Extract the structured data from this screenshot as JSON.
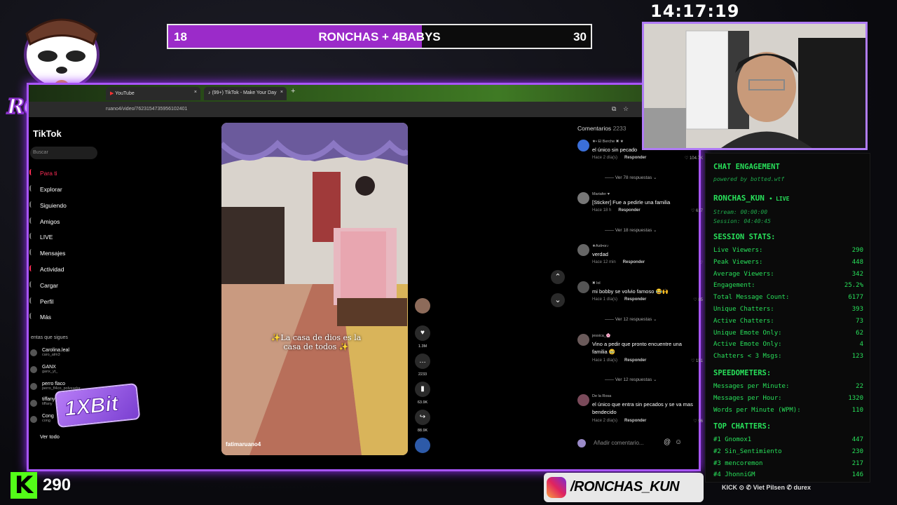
{
  "clock": "14:17:19",
  "goal": {
    "left": "18",
    "title": "RONCHAS + 4BABYS",
    "right": "30",
    "progress_fraction": 0.6
  },
  "brand": {
    "logo_text": "RONCHAS"
  },
  "browser": {
    "tabs": [
      {
        "label": "YouTube"
      },
      {
        "label": "(99+) TikTok - Make Your Day"
      }
    ],
    "url": "ruano4/video/7623154735956102401"
  },
  "tiktok": {
    "logo": "TikTok",
    "search_placeholder": "Buscar",
    "nav": [
      "Para ti",
      "Explorar",
      "Siguiendo",
      "Amigos",
      "LIVE",
      "Mensajes",
      "Actividad",
      "Cargar",
      "Perfil",
      "Más"
    ],
    "following_header": "entas que sigues",
    "accounts": [
      {
        "name": "Carolina.leal",
        "handle": "caro_alm3"
      },
      {
        "name": "GANX",
        "handle": "ganx_yt_"
      },
      {
        "name": "perro flaco",
        "handle": "perro_fl4co_polveador"
      },
      {
        "name": "tiffany",
        "handle": "tiffany"
      },
      {
        "name": "Cong",
        "handle": "cong"
      }
    ],
    "see_all": "Ver todo",
    "video": {
      "caption": "✨La casa de dios es la casa de todos ✨",
      "user": "fatimaruano4",
      "actions": {
        "likes": "1.3M",
        "comments": "2233",
        "saves": "63.9K",
        "shares": "88.9K"
      }
    },
    "comments": {
      "header": "Comentarios",
      "count": "2233",
      "input_placeholder": "Añadir comentario...",
      "items": [
        {
          "user": "★• El Berche ✖ ★",
          "text": "el único sin pecado",
          "time": "Hace 2 día(s)",
          "reply": "Responder",
          "likes": "104.7K",
          "more": "Ver 78 respuestas"
        },
        {
          "user": "Mariafer ♥",
          "text": "[Sticker] Fue a pedirle una familia",
          "time": "Hace 18 h",
          "reply": "Responder",
          "likes": "617",
          "more": "Ver 18 respuestas"
        },
        {
          "user": "★Asti•or♪",
          "text": "verdad",
          "time": "Hace 12 min",
          "reply": "Responder",
          "likes": "",
          "more": ""
        },
        {
          "user": "✖ lol",
          "text": "mi bobby se volvio famoso 😂🙌",
          "time": "Hace 1 día(s)",
          "reply": "Responder",
          "likes": "85",
          "more": "Ver 12 respuestas"
        },
        {
          "user": "jessica_🌸",
          "text": "Vino a pedir que pronto encuentre una familia 🥹",
          "time": "Hace 1 día(s)",
          "reply": "Responder",
          "likes": "151",
          "more": "Ver 12 respuestas"
        },
        {
          "user": "De la Rosa",
          "text": "el único que entra sin pecados y se va mas bendecido",
          "time": "Hace 2 día(s)",
          "reply": "Responder",
          "likes": "96",
          "more": ""
        }
      ]
    }
  },
  "chat_engagement": {
    "title": "CHAT ENGAGEMENT",
    "powered": "powered by botted.wtf",
    "channel": "RONCHAS_KUN",
    "live": "• LIVE",
    "stream": "Stream: 00:00:00",
    "session": "Session: 04:40:45",
    "session_stats_hdr": "SESSION STATS:",
    "stats": [
      {
        "label": "Live Viewers:",
        "value": "290"
      },
      {
        "label": "Peak Viewers:",
        "value": "448"
      },
      {
        "label": "Average Viewers:",
        "value": "342"
      },
      {
        "label": "Engagement:",
        "value": "25.2%"
      },
      {
        "label": "Total Message Count:",
        "value": "6177"
      },
      {
        "label": "Unique Chatters:",
        "value": "393"
      },
      {
        "label": "Active Chatters:",
        "value": "73"
      },
      {
        "label": "Unique Emote Only:",
        "value": "62"
      },
      {
        "label": "Active Emote Only:",
        "value": "4"
      },
      {
        "label": "Chatters < 3 Msgs:",
        "value": "123"
      }
    ],
    "speedo_hdr": "SPEEDOMETERS:",
    "speedo": [
      {
        "label": "Messages per Minute:",
        "value": "22"
      },
      {
        "label": "Messages per Hour:",
        "value": "1320"
      },
      {
        "label": "Words per Minute (WPM):",
        "value": "110"
      }
    ],
    "top_hdr": "TOP CHATTERS:",
    "top": [
      {
        "label": "#1 Gnomox1",
        "value": "447"
      },
      {
        "label": "#2 Sin_Sentimiento",
        "value": "230"
      },
      {
        "label": "#3 mencoremon",
        "value": "217"
      },
      {
        "label": "#4 JhonniGM",
        "value": "146"
      }
    ]
  },
  "bottom": {
    "kick_count": "290",
    "social_handle": "/RONCHAS_KUN",
    "sponsors": "KICK ⊙ ✆ Viet Pilsen ✆ durex",
    "sticker": "1XBit"
  }
}
